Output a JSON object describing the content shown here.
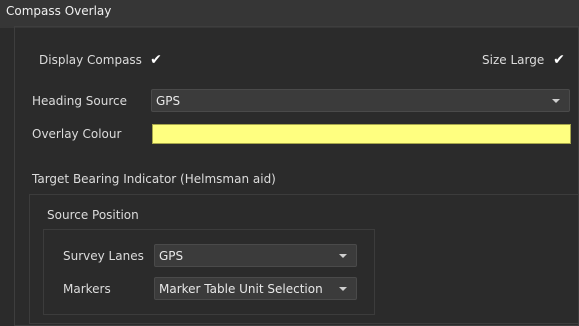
{
  "panel": {
    "title": "Compass Overlay"
  },
  "display": {
    "compass_label": "Display Compass",
    "compass_checked": true,
    "size_label": "Size Large",
    "size_checked": true
  },
  "heading": {
    "label": "Heading Source",
    "value": "GPS"
  },
  "overlay": {
    "label": "Overlay Colour",
    "color": "#ffff80"
  },
  "target": {
    "title": "Target Bearing Indicator (Helmsman aid)",
    "source_position_title": "Source Position",
    "survey_lanes_label": "Survey Lanes",
    "survey_lanes_value": "GPS",
    "markers_label": "Markers",
    "markers_value": "Marker Table Unit Selection"
  },
  "check_glyph": "✔"
}
